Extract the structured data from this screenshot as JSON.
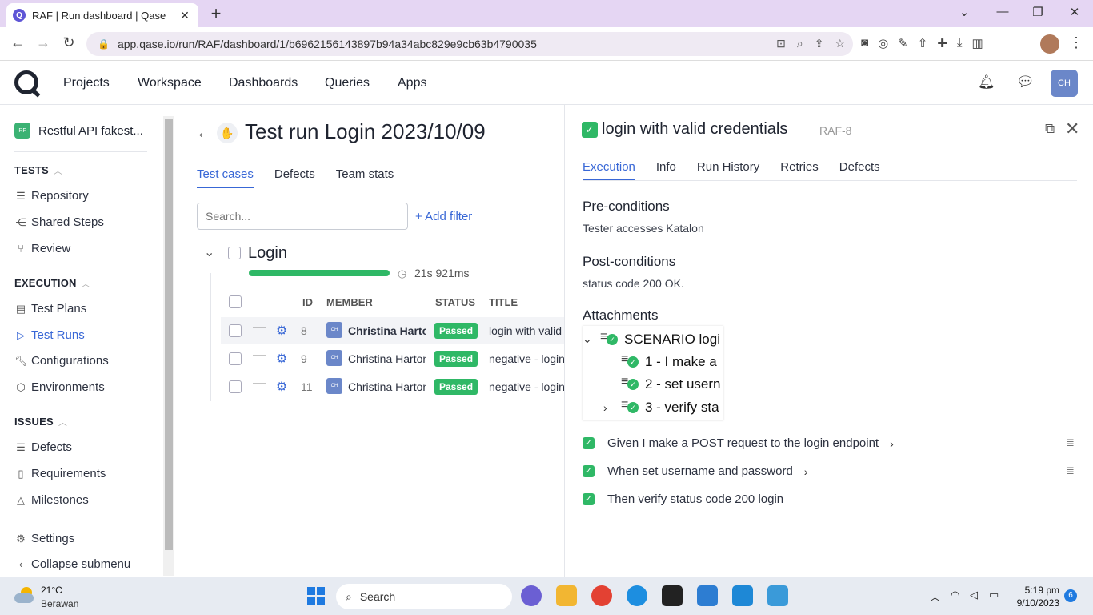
{
  "browser": {
    "tab_title": "RAF | Run dashboard | Qase",
    "url": "app.qase.io/run/RAF/dashboard/1/b6962156143897b94a34abc829e9cb63b4790035"
  },
  "topnav": {
    "items": [
      "Projects",
      "Workspace",
      "Dashboards",
      "Queries",
      "Apps"
    ],
    "avatar": "CH"
  },
  "sidebar": {
    "project_badge": "RF",
    "project_name": "Restful API fakest...",
    "sections": {
      "tests": "TESTS",
      "execution": "EXECUTION",
      "issues": "ISSUES"
    },
    "items": {
      "repository": "Repository",
      "shared_steps": "Shared Steps",
      "review": "Review",
      "test_plans": "Test Plans",
      "test_runs": "Test Runs",
      "configurations": "Configurations",
      "environments": "Environments",
      "defects": "Defects",
      "requirements": "Requirements",
      "milestones": "Milestones",
      "settings": "Settings",
      "collapse": "Collapse submenu"
    }
  },
  "main": {
    "title": "Test run Login 2023/10/09",
    "tabs": [
      "Test cases",
      "Defects",
      "Team stats"
    ],
    "search_placeholder": "Search...",
    "add_filter": "+ Add filter",
    "suite": {
      "name": "Login",
      "duration": "21s 921ms"
    },
    "columns": {
      "id": "ID",
      "member": "MEMBER",
      "status": "STATUS",
      "title": "TITLE"
    },
    "rows": [
      {
        "id": "8",
        "avatar": "CH",
        "member": "Christina Hartono",
        "status": "Passed",
        "title": "login with valid credentials"
      },
      {
        "id": "9",
        "avatar": "CH",
        "member": "Christina Hartono",
        "status": "Passed",
        "title": "negative - login"
      },
      {
        "id": "11",
        "avatar": "CH",
        "member": "Christina Hartono",
        "status": "Passed",
        "title": "negative - login"
      }
    ]
  },
  "panel": {
    "title": "login with valid credentials",
    "case_id": "RAF-8",
    "tabs": [
      "Execution",
      "Info",
      "Run History",
      "Retries",
      "Defects"
    ],
    "preconditions_label": "Pre-conditions",
    "preconditions": "Tester accesses Katalon",
    "postconditions_label": "Post-conditions",
    "postconditions": "status code 200 OK.",
    "attachments_label": "Attachments",
    "attachment_lines": [
      "SCENARIO logi",
      "1 - I make a",
      "2 - set usern",
      "3 - verify sta"
    ],
    "steps": [
      "Given I make a POST request to the login endpoint",
      "When set username and password",
      "Then verify status code 200 login"
    ]
  },
  "taskbar": {
    "temperature": "21°C",
    "weather": "Berawan",
    "search": "Search",
    "time": "5:19 pm",
    "date": "9/10/2023",
    "notifications": "6"
  },
  "colors": {
    "accent": "#3867d6",
    "passed": "#2fb866"
  }
}
